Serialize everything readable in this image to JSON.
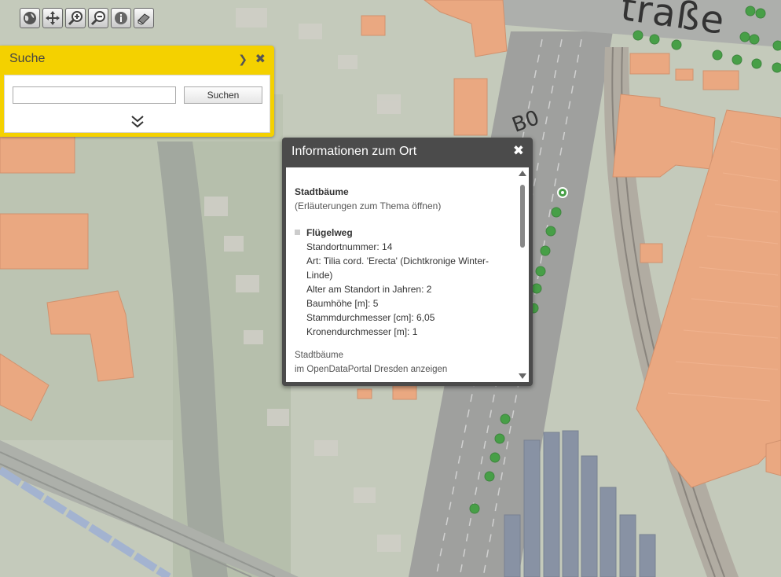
{
  "map": {
    "street_label": "traße",
    "road_label": "B0",
    "colors": {
      "building": "#e69566",
      "tree_marker": "#1f8a1f",
      "panel_header": "#f4d100"
    },
    "tree_points": [
      {
        "x": 0.0,
        "y": 0.0
      },
      {
        "x": 0.0,
        "y": 0.0
      }
    ]
  },
  "toolbar": {
    "tools": [
      {
        "icon": "globe-icon"
      },
      {
        "icon": "pan-icon"
      },
      {
        "icon": "zoom-in-icon"
      },
      {
        "icon": "zoom-out-icon"
      },
      {
        "icon": "info-icon"
      },
      {
        "icon": "eraser-icon"
      }
    ]
  },
  "search": {
    "title": "Suche",
    "button_label": "Suchen",
    "input_value": "",
    "arrow_icon": "chevron-right-icon",
    "close_icon": "close-icon",
    "expand_icon": "double-chevron-down-icon"
  },
  "info": {
    "title": "Informationen zum Ort",
    "close_icon": "close-icon",
    "theme_heading": "Stadtbäume",
    "theme_link": "(Erläuterungen zum Thema öffnen)",
    "feature": {
      "name": "Flügelweg",
      "attributes": [
        "Standortnummer: 14",
        "Art: Tilia cord. 'Erecta' (Dichtkronige Winter-Linde)",
        "Alter am Standort in Jahren: 2",
        "Baumhöhe [m]: 5",
        "Stammdurchmesser [cm]: 6,05",
        "Kronendurchmesser [m]: 1"
      ]
    },
    "footer_line1": "Stadtbäume",
    "footer_line2": "im OpenDataPortal Dresden anzeigen"
  }
}
